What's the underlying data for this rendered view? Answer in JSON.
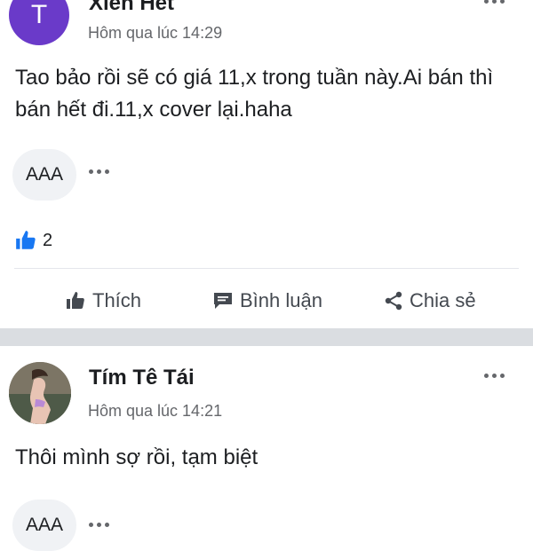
{
  "posts": [
    {
      "author": "Xiên Hết",
      "avatar_letter": "T",
      "avatar_color": "#6a3ac9",
      "timestamp": "Hôm qua lúc 14:29",
      "body": "Tao bảo rồi sẽ có giá 11,x trong tuần này.Ai bán thì bán hết đi.11,x cover lại.haha",
      "reaction_pill": "AAA",
      "like_count": "2"
    },
    {
      "author": "Tím Tê Tái",
      "timestamp": "Hôm qua lúc 14:21",
      "body": "Thôi mình sợ rồi, tạm biệt",
      "reaction_pill": "AAA"
    }
  ],
  "actions": {
    "like": "Thích",
    "comment": "Bình luận",
    "share": "Chia sẻ"
  },
  "colors": {
    "accent_blue": "#1877f2",
    "text_secondary": "#65676b",
    "divider": "#dadde1"
  }
}
